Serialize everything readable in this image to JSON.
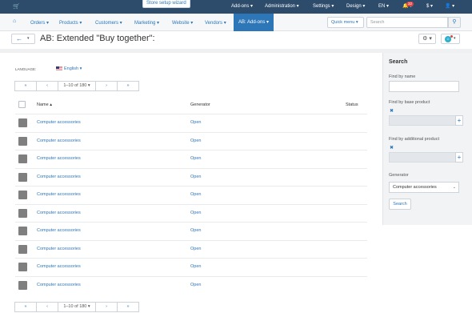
{
  "topbar": {
    "cart_icon": "cart-icon",
    "wizard": "Store setup wizard",
    "menus": [
      "Add-ons",
      "Administration",
      "Settings",
      "Design",
      "EN",
      "$"
    ],
    "notifications_count": "32"
  },
  "nav": {
    "items": [
      "Orders",
      "Products",
      "Customers",
      "Marketing",
      "Website",
      "Vendors",
      "AB: Add-ons"
    ],
    "quick_menu": "Quick menu",
    "search_placeholder": "Search"
  },
  "page": {
    "title": "AB: Extended \"Buy together\":"
  },
  "language": {
    "label": "Language:",
    "value": "English"
  },
  "pager": {
    "first": "«",
    "prev": "‹",
    "range": "1–10 of 180",
    "next": "›",
    "last": "»"
  },
  "table": {
    "columns": {
      "name": "Name",
      "generator": "Generator",
      "status": "Status"
    },
    "rows": [
      {
        "name": "Computer accessories",
        "generator": "Open"
      },
      {
        "name": "Computer accessories",
        "generator": "Open"
      },
      {
        "name": "Computer accessories",
        "generator": "Open"
      },
      {
        "name": "Computer accessories",
        "generator": "Open"
      },
      {
        "name": "Computer accessories",
        "generator": "Open"
      },
      {
        "name": "Computer accessories",
        "generator": "Open"
      },
      {
        "name": "Computer accessories",
        "generator": "Open"
      },
      {
        "name": "Computer accessories",
        "generator": "Open"
      },
      {
        "name": "Computer accessories",
        "generator": "Open"
      },
      {
        "name": "Computer accessories",
        "generator": "Open"
      }
    ]
  },
  "sidebar": {
    "title": "Search",
    "find_by_name": "Find by name",
    "find_by_base": "Find by base product",
    "find_by_additional": "Find by additional product",
    "generator_label": "Generator",
    "generator_value": "Computer accessories",
    "search_button": "Search"
  },
  "colors": {
    "topbar": "#2d4b6b",
    "accent": "#2d76b8",
    "thumb": "#7f7f7f"
  }
}
